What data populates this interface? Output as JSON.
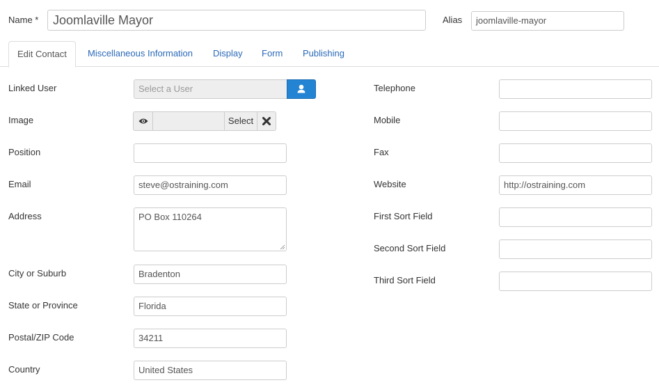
{
  "header": {
    "name_label": "Name *",
    "name_value": "Joomlaville Mayor",
    "alias_label": "Alias",
    "alias_value": "joomlaville-mayor"
  },
  "tabs": [
    {
      "label": "Edit Contact",
      "active": true
    },
    {
      "label": "Miscellaneous Information",
      "active": false
    },
    {
      "label": "Display",
      "active": false
    },
    {
      "label": "Form",
      "active": false
    },
    {
      "label": "Publishing",
      "active": false
    }
  ],
  "left": {
    "linked_user": {
      "label": "Linked User",
      "placeholder": "Select a User",
      "button_icon": "user-icon"
    },
    "image": {
      "label": "Image",
      "preview_icon": "eye-icon",
      "select_label": "Select",
      "clear_icon": "close-icon"
    },
    "position": {
      "label": "Position",
      "value": ""
    },
    "email": {
      "label": "Email",
      "value": "steve@ostraining.com"
    },
    "address": {
      "label": "Address",
      "value": "PO Box 110264"
    },
    "city": {
      "label": "City or Suburb",
      "value": "Bradenton"
    },
    "state": {
      "label": "State or Province",
      "value": "Florida"
    },
    "postcode": {
      "label": "Postal/ZIP Code",
      "value": "34211"
    },
    "country": {
      "label": "Country",
      "value": "United States"
    }
  },
  "right": {
    "telephone": {
      "label": "Telephone",
      "value": ""
    },
    "mobile": {
      "label": "Mobile",
      "value": ""
    },
    "fax": {
      "label": "Fax",
      "value": ""
    },
    "website": {
      "label": "Website",
      "value": "http://ostraining.com"
    },
    "sort1": {
      "label": "First Sort Field",
      "value": ""
    },
    "sort2": {
      "label": "Second Sort Field",
      "value": ""
    },
    "sort3": {
      "label": "Third Sort Field",
      "value": ""
    }
  },
  "colors": {
    "accent": "#2384d3",
    "link": "#2a69b8"
  }
}
